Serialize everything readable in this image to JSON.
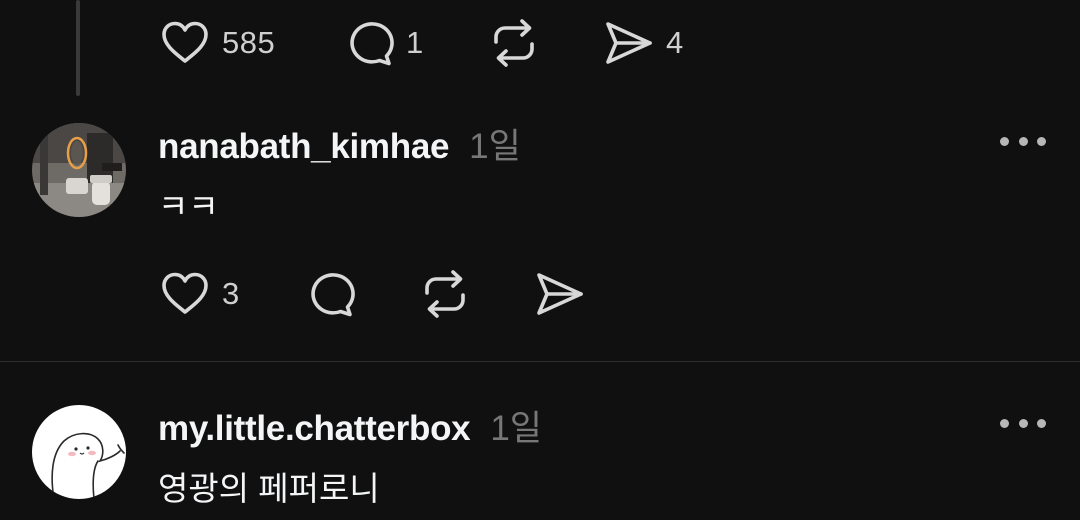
{
  "top_actions": {
    "like_count": "585",
    "reply_count": "1",
    "share_count": "4"
  },
  "posts": [
    {
      "username": "nanabath_kimhae",
      "time": "1일",
      "text": "ㅋㅋ",
      "like_count": "3",
      "avatar_icon": "bathroom-photo-avatar"
    },
    {
      "username": "my.little.chatterbox",
      "time": "1일",
      "text": "영광의 페퍼로니",
      "avatar_icon": "cartoon-character-avatar"
    }
  ],
  "icons": {
    "like": "heart-icon",
    "reply": "comment-bubble-icon",
    "repost": "repost-icon",
    "share": "send-icon",
    "more": "more-options-icon"
  },
  "colors": {
    "background": "#101010",
    "text": "#f3f5f7",
    "muted": "#777777",
    "icon": "#d8d8d8"
  }
}
